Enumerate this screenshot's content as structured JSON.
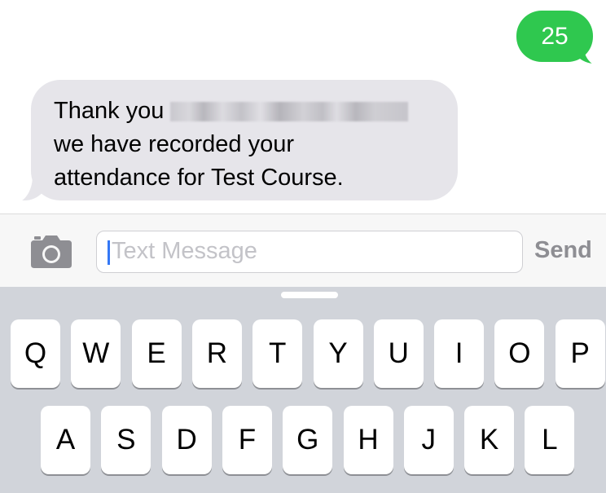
{
  "thread": {
    "sent_message": "25",
    "received_message": {
      "line1_prefix": "Thank you",
      "line2": "we have recorded your",
      "line3": "attendance for Test Course."
    }
  },
  "composer": {
    "placeholder": "Text Message",
    "send_label": "Send"
  },
  "keyboard": {
    "row1": [
      "Q",
      "W",
      "E",
      "R",
      "T",
      "Y",
      "U",
      "I",
      "O",
      "P"
    ],
    "row2": [
      "A",
      "S",
      "D",
      "F",
      "G",
      "H",
      "J",
      "K",
      "L"
    ]
  },
  "colors": {
    "sent_bubble": "#2fc84f",
    "received_bubble": "#e6e5ea",
    "caret": "#3478f6",
    "keyboard_bg": "#d1d4da"
  }
}
